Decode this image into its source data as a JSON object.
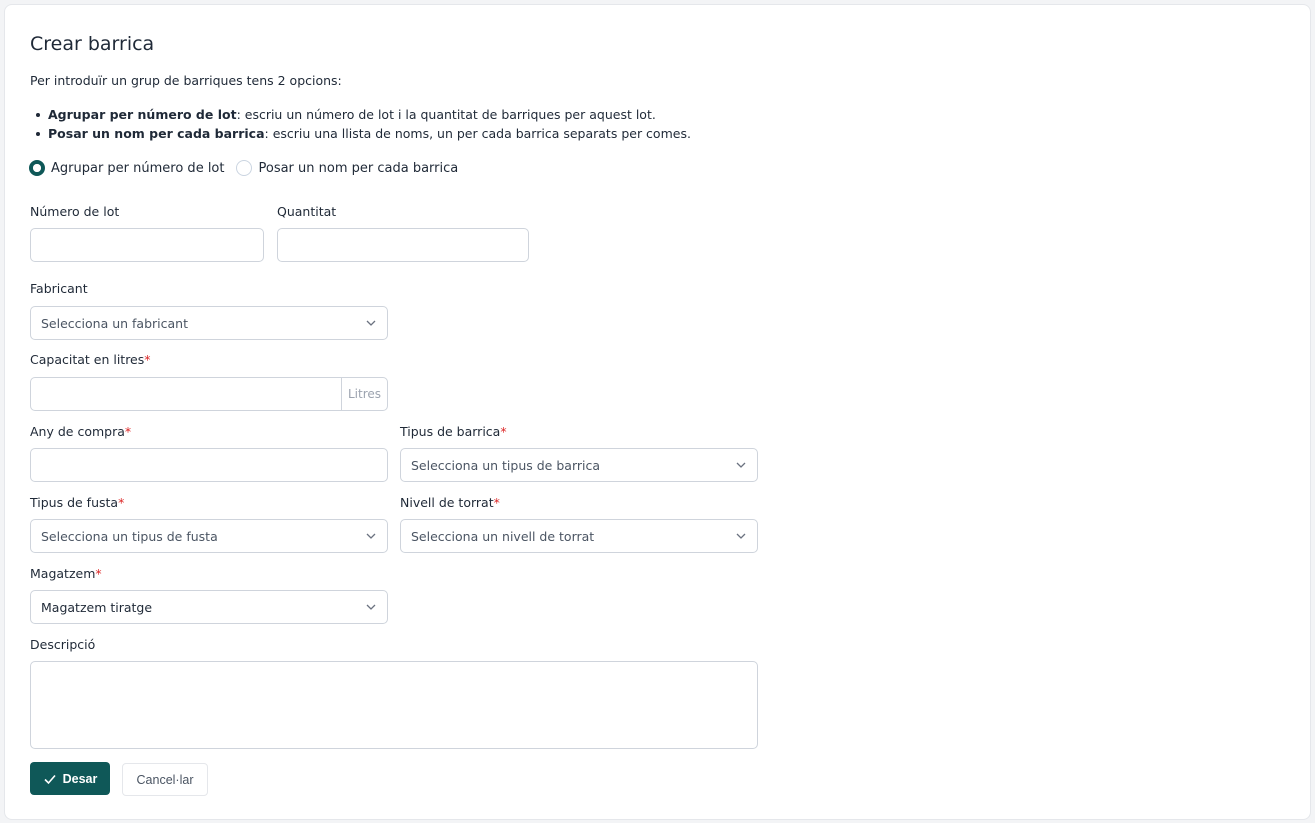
{
  "title": "Crear barrica",
  "intro": "Per introduïr un grup de barriques tens 2 opcions:",
  "bullets": [
    {
      "bold": "Agrupar per número de lot",
      "text": ": escriu un número de lot i la quantitat de barriques per aquest lot."
    },
    {
      "bold": "Posar un nom per cada barrica",
      "text": ": escriu una llista de noms, un per cada barrica separats per comes."
    }
  ],
  "mode_options": [
    {
      "label": "Agrupar per número de lot",
      "checked": true
    },
    {
      "label": "Posar un nom per cada barrica",
      "checked": false
    }
  ],
  "fields": {
    "lot": {
      "label": "Número de lot",
      "value": ""
    },
    "quantity": {
      "label": "Quantitat",
      "value": ""
    },
    "manufacturer": {
      "label": "Fabricant",
      "placeholder": "Selecciona un fabricant"
    },
    "capacity": {
      "label": "Capacitat en litres",
      "required": "*",
      "value": "",
      "suffix": "Litres"
    },
    "purchase_year": {
      "label": "Any de compra",
      "required": "*",
      "value": ""
    },
    "barrel_type": {
      "label": "Tipus de barrica",
      "required": "*",
      "placeholder": "Selecciona un tipus de barrica"
    },
    "wood_type": {
      "label": "Tipus de fusta",
      "required": "*",
      "placeholder": "Selecciona un tipus de fusta"
    },
    "toast_level": {
      "label": "Nivell de torrat",
      "required": "*",
      "placeholder": "Selecciona un nivell de torrat"
    },
    "warehouse": {
      "label": "Magatzem",
      "required": "*",
      "value": "Magatzem tiratge"
    },
    "description": {
      "label": "Descripció",
      "value": ""
    }
  },
  "buttons": {
    "save": "Desar",
    "cancel": "Cancel·lar"
  },
  "colors": {
    "accent": "#0f5858",
    "required": "#dc2626"
  }
}
